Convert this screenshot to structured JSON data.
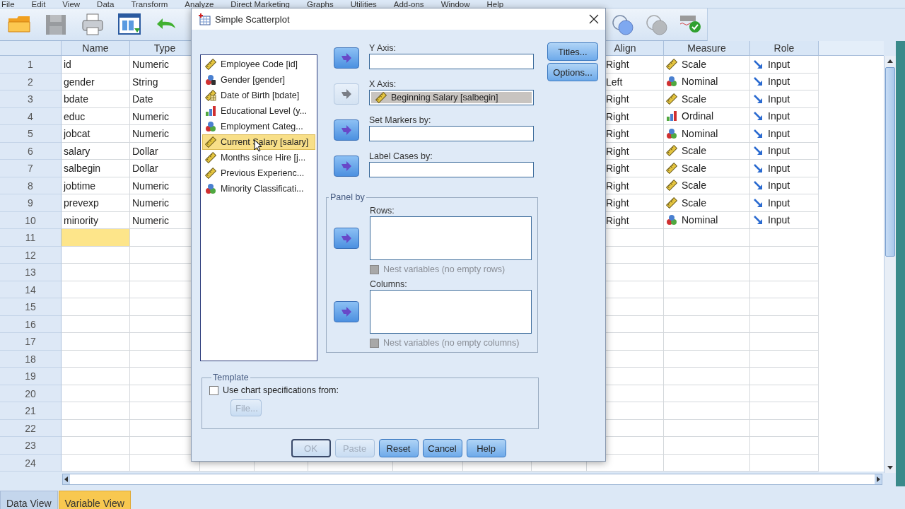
{
  "menu": [
    "File",
    "Edit",
    "View",
    "Data",
    "Transform",
    "Analyze",
    "Direct Marketing",
    "Graphs",
    "Utilities",
    "Add-ons",
    "Window",
    "Help"
  ],
  "toolbar": [
    {
      "kind": "open",
      "disabled": false
    },
    {
      "kind": "save",
      "disabled": true
    },
    {
      "kind": "print",
      "disabled": false
    },
    {
      "kind": "dataview",
      "disabled": false
    },
    {
      "kind": "undo",
      "disabled": false
    }
  ],
  "toolbar_right": [
    {
      "kind": "circles",
      "disabled": false
    },
    {
      "kind": "circles",
      "disabled": true
    },
    {
      "kind": "spell",
      "disabled": false
    }
  ],
  "columns": [
    "Name",
    "Type",
    "Align",
    "Measure",
    "Role"
  ],
  "rows": [
    {
      "number": "1",
      "name": "id",
      "type": "Numeric",
      "align": "Right",
      "measure": {
        "label": "Scale",
        "kind": "scale"
      },
      "role": "Input",
      "selected": false
    },
    {
      "number": "2",
      "name": "gender",
      "type": "String",
      "align": "Left",
      "measure": {
        "label": "Nominal",
        "kind": "nominal"
      },
      "role": "Input",
      "selected": false
    },
    {
      "number": "3",
      "name": "bdate",
      "type": "Date",
      "align": "Right",
      "measure": {
        "label": "Scale",
        "kind": "scale"
      },
      "role": "Input",
      "selected": false
    },
    {
      "number": "4",
      "name": "educ",
      "type": "Numeric",
      "align": "Right",
      "measure": {
        "label": "Ordinal",
        "kind": "ordinal"
      },
      "role": "Input",
      "selected": false
    },
    {
      "number": "5",
      "name": "jobcat",
      "type": "Numeric",
      "align": "Right",
      "measure": {
        "label": "Nominal",
        "kind": "nominal"
      },
      "role": "Input",
      "selected": false
    },
    {
      "number": "6",
      "name": "salary",
      "type": "Dollar",
      "align": "Right",
      "measure": {
        "label": "Scale",
        "kind": "scale"
      },
      "role": "Input",
      "selected": false
    },
    {
      "number": "7",
      "name": "salbegin",
      "type": "Dollar",
      "align": "Right",
      "measure": {
        "label": "Scale",
        "kind": "scale"
      },
      "role": "Input",
      "selected": false
    },
    {
      "number": "8",
      "name": "jobtime",
      "type": "Numeric",
      "align": "Right",
      "measure": {
        "label": "Scale",
        "kind": "scale"
      },
      "role": "Input",
      "selected": false
    },
    {
      "number": "9",
      "name": "prevexp",
      "type": "Numeric",
      "align": "Right",
      "measure": {
        "label": "Scale",
        "kind": "scale"
      },
      "role": "Input",
      "selected": false
    },
    {
      "number": "10",
      "name": "minority",
      "type": "Numeric",
      "align": "Right",
      "measure": {
        "label": "Nominal",
        "kind": "nominal"
      },
      "role": "Input",
      "selected": false
    },
    {
      "number": "11",
      "selected": true
    },
    {
      "number": "12",
      "selected": false
    },
    {
      "number": "13",
      "selected": false
    },
    {
      "number": "14",
      "selected": false
    },
    {
      "number": "15",
      "selected": false
    },
    {
      "number": "16",
      "selected": false
    },
    {
      "number": "17",
      "selected": false
    },
    {
      "number": "18",
      "selected": false
    },
    {
      "number": "19",
      "selected": false
    },
    {
      "number": "20",
      "selected": false
    },
    {
      "number": "21",
      "selected": false
    },
    {
      "number": "22",
      "selected": false
    },
    {
      "number": "23",
      "selected": false
    },
    {
      "number": "24",
      "selected": false
    }
  ],
  "tabs": [
    {
      "label": "Data View",
      "selected": false
    },
    {
      "label": "Variable View",
      "selected": true
    }
  ],
  "dialog": {
    "title": "Simple Scatterplot",
    "variables": [
      {
        "label": "Employee Code [id]",
        "kind": "scale",
        "selected": false
      },
      {
        "label": "Gender [gender]",
        "kind": "nominal-string",
        "selected": false
      },
      {
        "label": "Date of Birth [bdate]",
        "kind": "date",
        "selected": false
      },
      {
        "label": "Educational Level (y...",
        "kind": "ordinal",
        "selected": false
      },
      {
        "label": "Employment Categ...",
        "kind": "nominal",
        "selected": false
      },
      {
        "label": "Current Salary [salary]",
        "kind": "scale",
        "selected": true
      },
      {
        "label": "Months since Hire [j...",
        "kind": "scale",
        "selected": false
      },
      {
        "label": "Previous Experienc...",
        "kind": "scale",
        "selected": false
      },
      {
        "label": "Minority Classificati...",
        "kind": "nominal",
        "selected": false
      }
    ],
    "targets": [
      {
        "label": "Y Axis:",
        "arrow_disabled": false
      },
      {
        "label": "X Axis:",
        "arrow_disabled": true,
        "value": {
          "label": "Beginning Salary [salbegin]",
          "kind": "scale"
        }
      },
      {
        "label": "Set Markers by:",
        "arrow_disabled": false
      },
      {
        "label": "Label Cases by:",
        "arrow_disabled": false
      }
    ],
    "side_buttons": [
      "Titles...",
      "Options..."
    ],
    "panel_by": {
      "legend": "Panel by",
      "sections": [
        {
          "label": "Rows:",
          "arrow_disabled": false,
          "nest": {
            "label": "Nest variables (no empty rows)",
            "checked": false,
            "disabled": true
          }
        },
        {
          "label": "Columns:",
          "arrow_disabled": false,
          "nest": {
            "label": "Nest variables (no empty columns)",
            "checked": false,
            "disabled": true
          }
        }
      ]
    },
    "template": {
      "legend": "Template",
      "option": {
        "label": "Use chart specifications from:",
        "checked": false
      },
      "file_button": {
        "label": "File...",
        "disabled": true
      }
    },
    "buttons": [
      {
        "label": "OK",
        "disabled": true,
        "default": true
      },
      {
        "label": "Paste",
        "disabled": true,
        "default": false
      },
      {
        "label": "Reset",
        "disabled": false,
        "default": false
      },
      {
        "label": "Cancel",
        "disabled": false,
        "default": false
      },
      {
        "label": "Help",
        "disabled": false,
        "default": false
      }
    ]
  }
}
